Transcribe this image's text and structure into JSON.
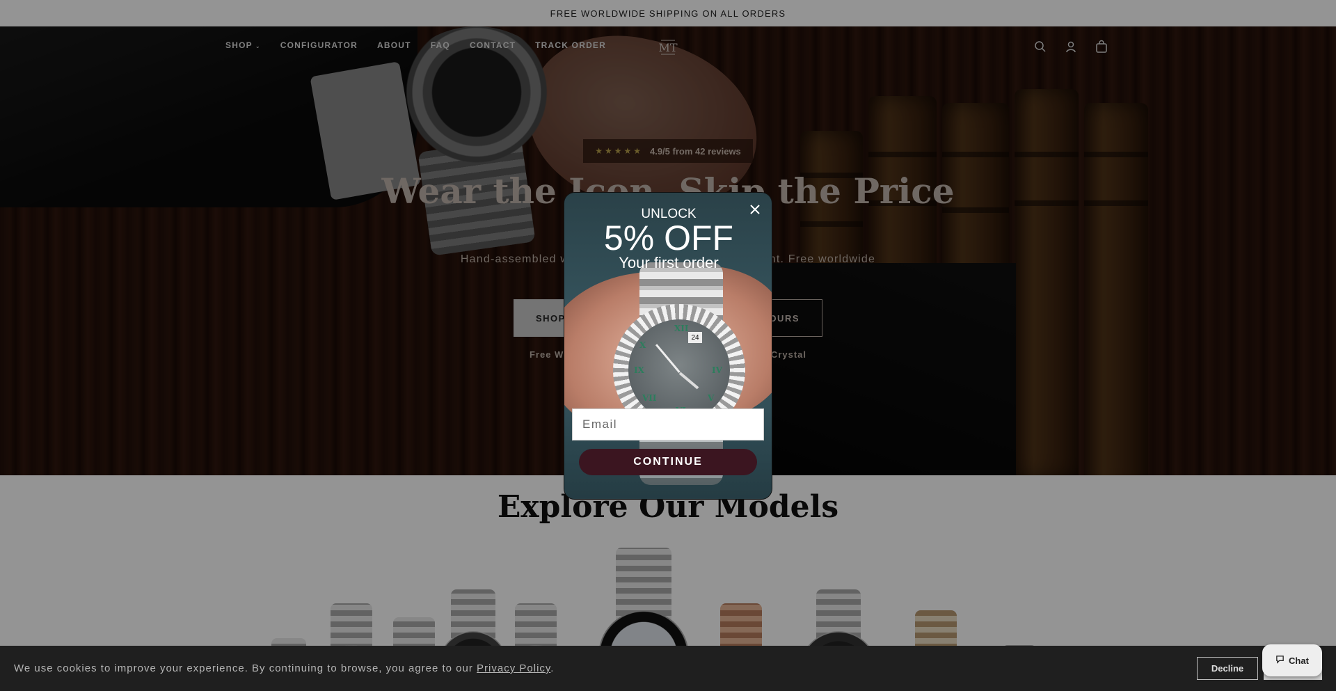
{
  "announcement": "FREE WORLDWIDE SHIPPING ON ALL ORDERS",
  "nav": {
    "links": [
      "SHOP",
      "CONFIGURATOR",
      "ABOUT",
      "FAQ",
      "CONTACT",
      "TRACK ORDER"
    ],
    "logo": "MT",
    "icons": [
      "search-icon",
      "account-icon",
      "cart-icon"
    ]
  },
  "hero": {
    "rating_stars": "★★★★★",
    "rating_text": "4.9/5 from 42 reviews",
    "title": "Wear the Icon. Skip the Price",
    "subtitle_left": "Hand-assembled watc",
    "subtitle_right": "ement. Free worldwide",
    "primary_button": "SHOP",
    "secondary_button": "OURS",
    "feature_left": "Free Wor",
    "feature_right": "e Crystal"
  },
  "models": {
    "title": "Explore Our Models"
  },
  "popup": {
    "kicker": "UNLOCK",
    "headline": "5% OFF",
    "subhead": "Your first order",
    "email_placeholder": "Email",
    "button": "CONTINUE",
    "date_window": "24"
  },
  "cookie": {
    "text": "We use cookies to improve your experience. By continuing to browse, you agree to our ",
    "link": "Privacy Policy",
    "period": ".",
    "decline": "Decline"
  },
  "chat": {
    "label": "Chat"
  },
  "colors": {
    "cta_button": "#3b1520",
    "cookie_bar": "#1f1f1f",
    "popup_bg": "#2f4b54"
  }
}
